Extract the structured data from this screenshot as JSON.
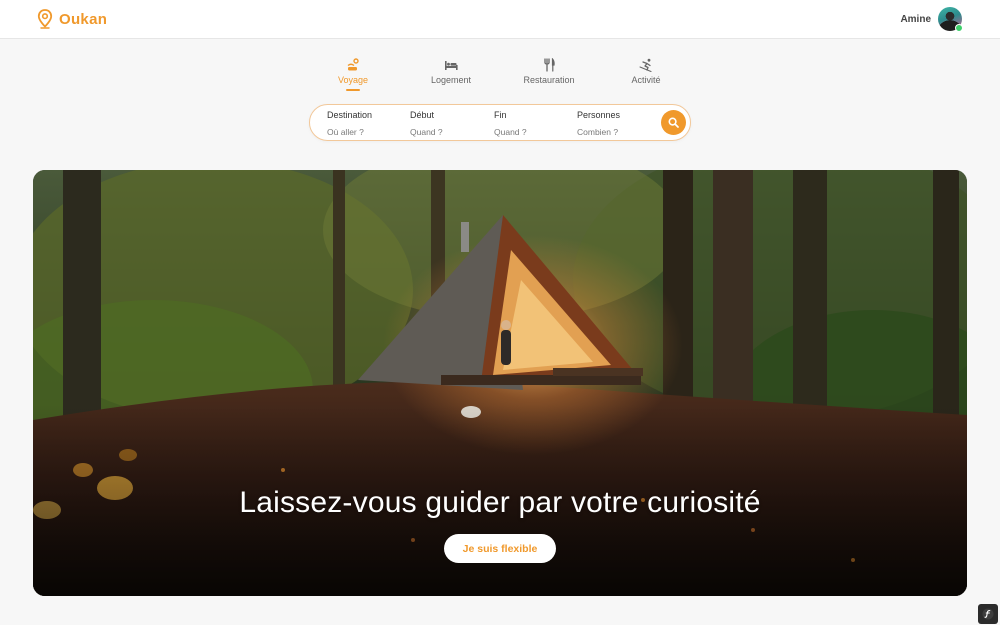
{
  "brand": {
    "name": "Oukan",
    "color": "#f0992c",
    "icon": "map-pin-icon"
  },
  "user": {
    "name": "Amine",
    "status": "online"
  },
  "tabs": [
    {
      "label": "Voyage",
      "icon": "travel-icon",
      "active": true
    },
    {
      "label": "Logement",
      "icon": "bed-icon",
      "active": false
    },
    {
      "label": "Restauration",
      "icon": "utensils-icon",
      "active": false
    },
    {
      "label": "Activité",
      "icon": "skier-icon",
      "active": false
    }
  ],
  "search": {
    "fields": [
      {
        "label": "Destination",
        "value": "Où aller ?"
      },
      {
        "label": "Début",
        "value": "Quand ?"
      },
      {
        "label": "Fin",
        "value": "Quand ?"
      },
      {
        "label": "Personnes",
        "value": "Combien ?"
      }
    ],
    "button_icon": "search-icon"
  },
  "hero": {
    "title": "Laissez-vous guider par votre curiosité",
    "button_label": "Je suis flexible"
  },
  "colors": {
    "accent": "#f0992c",
    "background": "#f7f7f7"
  }
}
